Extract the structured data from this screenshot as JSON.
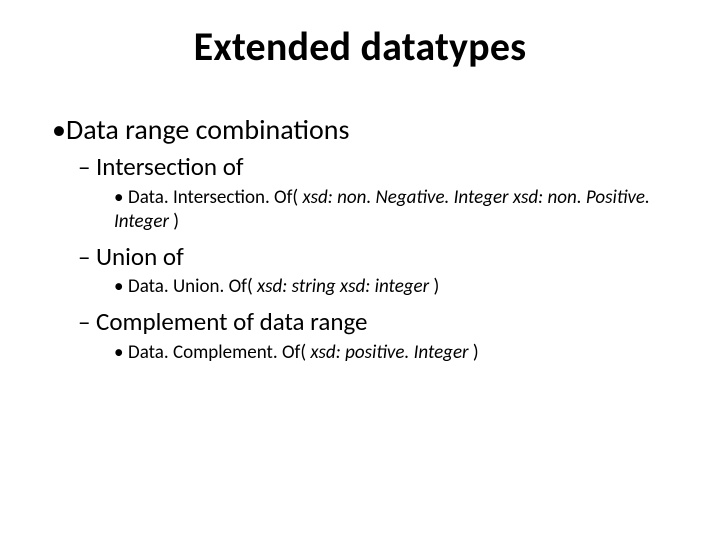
{
  "title": "Extended datatypes",
  "lvl1": {
    "bullet": "•",
    "text": "Data range combinations"
  },
  "sections": [
    {
      "dash": "–",
      "heading": "Intersection of",
      "item": {
        "dot": "•",
        "prefix": "Data. Intersection. Of( ",
        "args": "xsd: non. Negative. Integer xsd: non. Positive. Integer ",
        "suffix": ")"
      }
    },
    {
      "dash": "–",
      "heading": "Union of",
      "item": {
        "dot": "•",
        "prefix": "Data. Union. Of( ",
        "args": "xsd: string xsd: integer ",
        "suffix": ")"
      }
    },
    {
      "dash": "–",
      "heading": "Complement of data range",
      "item": {
        "dot": "•",
        "prefix": "Data. Complement. Of( ",
        "args": "xsd: positive. Integer ",
        "suffix": ")"
      }
    }
  ]
}
